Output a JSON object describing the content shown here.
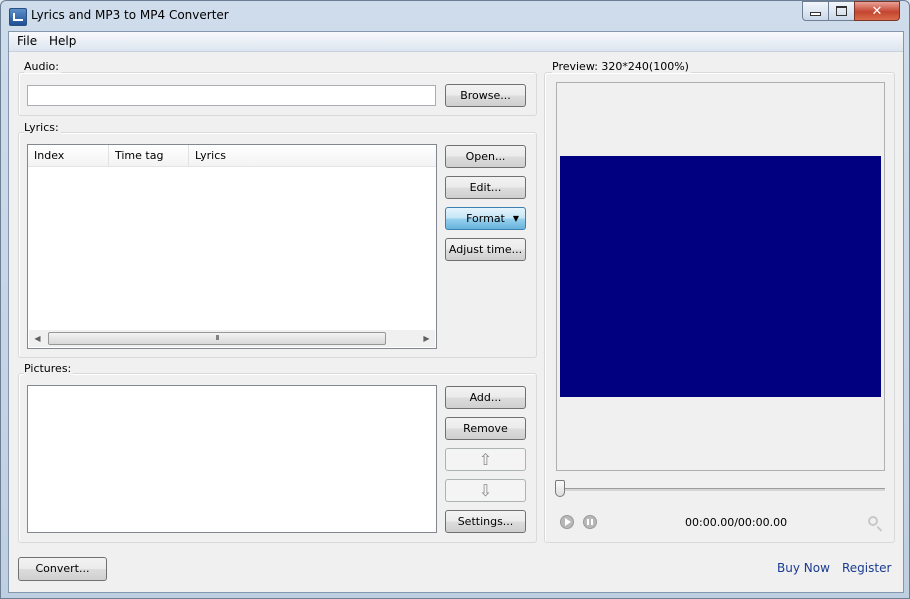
{
  "window": {
    "title": "Lyrics and MP3 to MP4 Converter",
    "close_glyph": "✕"
  },
  "menu": {
    "file": "File",
    "help": "Help"
  },
  "audio": {
    "label": "Audio:",
    "path_value": "",
    "browse_label": "Browse..."
  },
  "lyrics": {
    "label": "Lyrics:",
    "columns": [
      "Index",
      "Time tag",
      "Lyrics"
    ],
    "open_label": "Open...",
    "edit_label": "Edit...",
    "format_label": "Format",
    "adjust_label": "Adjust time...",
    "scroll_left": "◀",
    "scroll_right": "▶",
    "thumb_grip": "III"
  },
  "pictures": {
    "label": "Pictures:",
    "add_label": "Add...",
    "remove_label": "Remove",
    "up_glyph": "⇧",
    "down_glyph": "⇩",
    "settings_label": "Settings..."
  },
  "preview": {
    "label": "Preview: 320*240(100%)",
    "video_color": "#000080",
    "time": "00:00.00/00:00.00"
  },
  "footer": {
    "convert_label": "Convert...",
    "buy_now": "Buy Now",
    "register": "Register"
  }
}
